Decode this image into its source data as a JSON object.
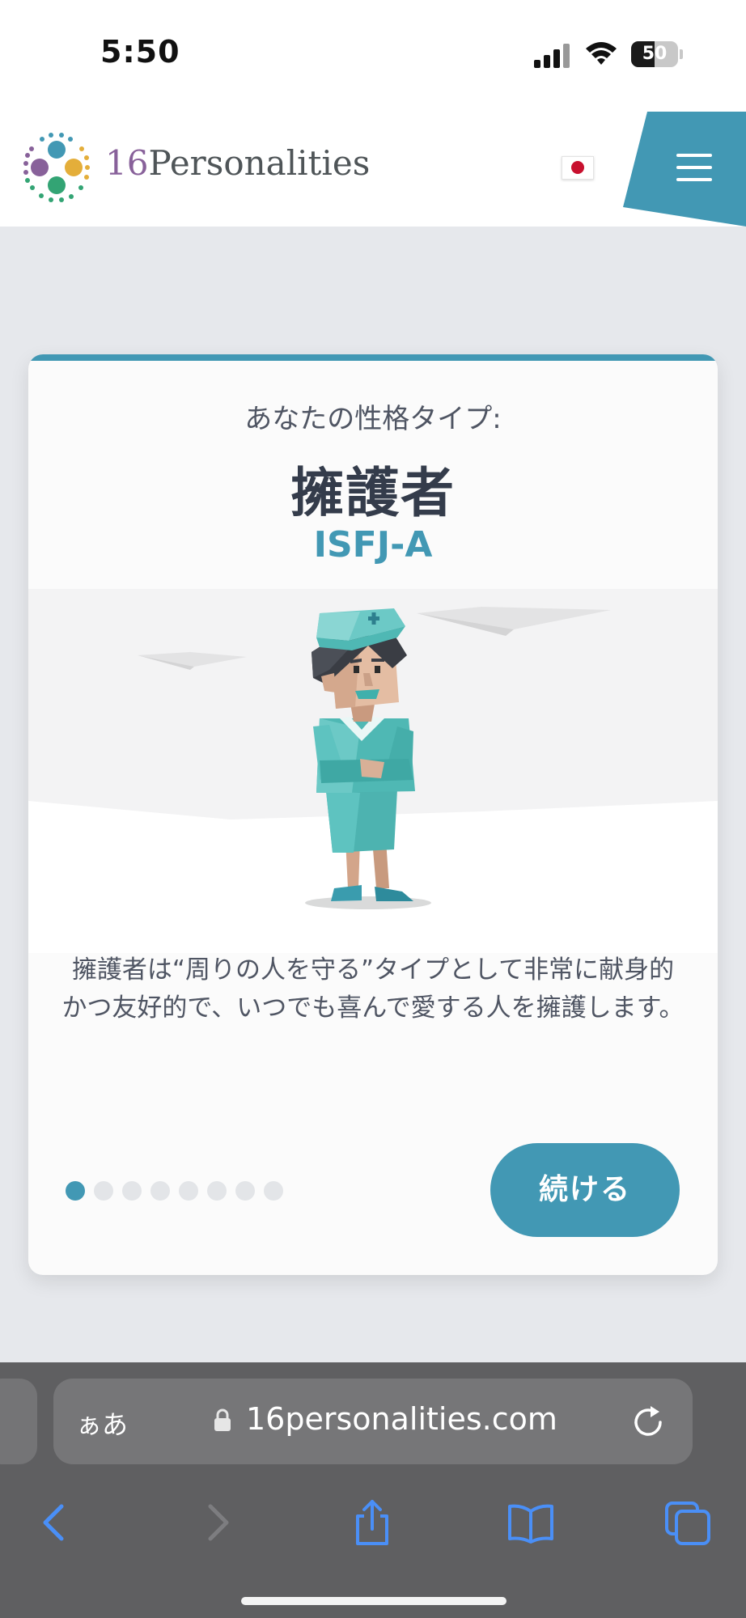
{
  "status_bar": {
    "time": "5:50",
    "battery_level": "50"
  },
  "header": {
    "logo_number": "16",
    "logo_word": "Personalities",
    "language_flag": "japan-flag-icon",
    "menu_icon": "hamburger-menu-icon",
    "accent_color": "#4298b4"
  },
  "card": {
    "intro": "あなたの性格タイプ:",
    "type_name": "擁護者",
    "type_code": "ISFJ-A",
    "description": "擁護者は“周りの人を守る”タイプとして非常に献身的かつ友好的で、いつでも喜んで愛する人を擁護します。",
    "pager": {
      "total": 8,
      "current": 1
    },
    "continue_label": "続ける"
  },
  "browser": {
    "aa_label": "ぁあ",
    "url": "16personalities.com",
    "toolbar_icons": [
      "back-icon",
      "forward-icon",
      "share-icon",
      "bookmarks-icon",
      "tabs-icon"
    ]
  }
}
